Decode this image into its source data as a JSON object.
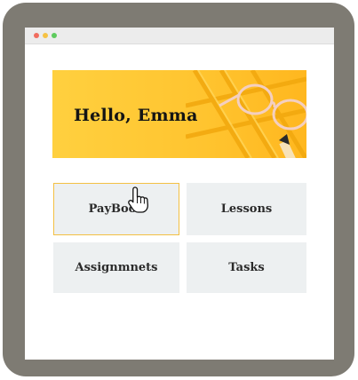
{
  "banner": {
    "greeting": "Hello, Emma"
  },
  "menu": {
    "cards": [
      {
        "label": "PayBook",
        "selected": true
      },
      {
        "label": "Lessons",
        "selected": false
      },
      {
        "label": "Assignmnets",
        "selected": false
      },
      {
        "label": "Tasks",
        "selected": false
      }
    ]
  },
  "colors": {
    "banner_yellow": "#ffc42f",
    "card_bg": "#edf0f1",
    "selected_border": "#f3c043",
    "frame_gray": "#7e7b73"
  },
  "icons": {
    "cursor": "hand-pointer-icon",
    "window_controls": [
      "close-dot-icon",
      "minimize-dot-icon",
      "maximize-dot-icon"
    ]
  }
}
